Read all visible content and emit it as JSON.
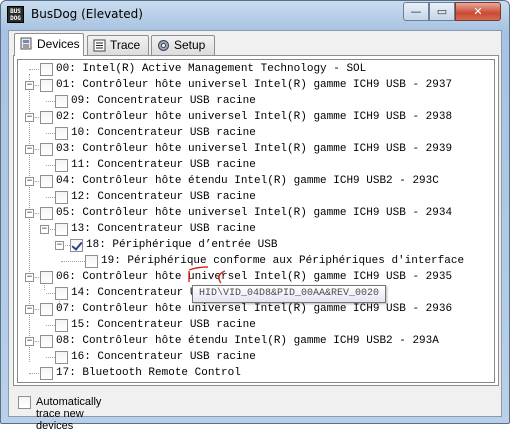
{
  "window": {
    "title": "BusDog (Elevated)",
    "app_icon_text": "BUS DOG",
    "minimize_label": "—",
    "maximize_label": "▭",
    "close_label": "✕"
  },
  "tabs": [
    {
      "label": "Devices",
      "active": true
    },
    {
      "label": "Trace",
      "active": false
    },
    {
      "label": "Setup",
      "active": false
    }
  ],
  "tree": {
    "nodes": [
      {
        "label": "00: Intel(R) Active Management Technology - SOL",
        "checked": false
      },
      {
        "label": "01: Contrôleur hôte universel Intel(R) gamme ICH9 USB - 2937",
        "checked": false
      },
      {
        "label": "09: Concentrateur USB racine",
        "checked": false
      },
      {
        "label": "02: Contrôleur hôte universel Intel(R) gamme ICH9 USB - 2938",
        "checked": false
      },
      {
        "label": "10: Concentrateur USB racine",
        "checked": false
      },
      {
        "label": "03: Contrôleur hôte universel Intel(R) gamme ICH9 USB - 2939",
        "checked": false
      },
      {
        "label": "11: Concentrateur USB racine",
        "checked": false
      },
      {
        "label": "04: Contrôleur hôte étendu Intel(R) gamme ICH9 USB2 - 293C",
        "checked": false
      },
      {
        "label": "12: Concentrateur USB racine",
        "checked": false
      },
      {
        "label": "05: Contrôleur hôte universel Intel(R) gamme ICH9 USB - 2934",
        "checked": false
      },
      {
        "label": "13: Concentrateur USB racine",
        "checked": false
      },
      {
        "label": "18: Périphérique d’entrée USB",
        "checked": true
      },
      {
        "label": "19: Périphérique conforme aux Périphériques d'interface",
        "checked": false
      },
      {
        "label": "06: Contrôleur hôte universel Intel(R) gamme ICH9 USB - 2935",
        "checked": false
      },
      {
        "label": "14: Concentrateur USB racine",
        "checked": false
      },
      {
        "label": "07: Contrôleur hôte universel Intel(R) gamme ICH9 USB - 2936",
        "checked": false
      },
      {
        "label": "15: Concentrateur USB racine",
        "checked": false
      },
      {
        "label": "08: Contrôleur hôte étendu Intel(R) gamme ICH9 USB2 - 293A",
        "checked": false
      },
      {
        "label": "16: Concentrateur USB racine",
        "checked": false
      },
      {
        "label": "17: Bluetooth Remote Control",
        "checked": false
      }
    ],
    "tooltip": "HID\\VID_04D8&PID_00AA&REV_0020",
    "expander_collapse": "−"
  },
  "auto_trace": {
    "label": "Automatically trace new devices",
    "checked": false
  },
  "colors": {
    "annotation_red": "#d9261c",
    "close_button": "#c94b33"
  },
  "icons": {
    "devices_tab": "devices-icon",
    "trace_tab": "trace-icon",
    "setup_tab": "gear-icon"
  }
}
